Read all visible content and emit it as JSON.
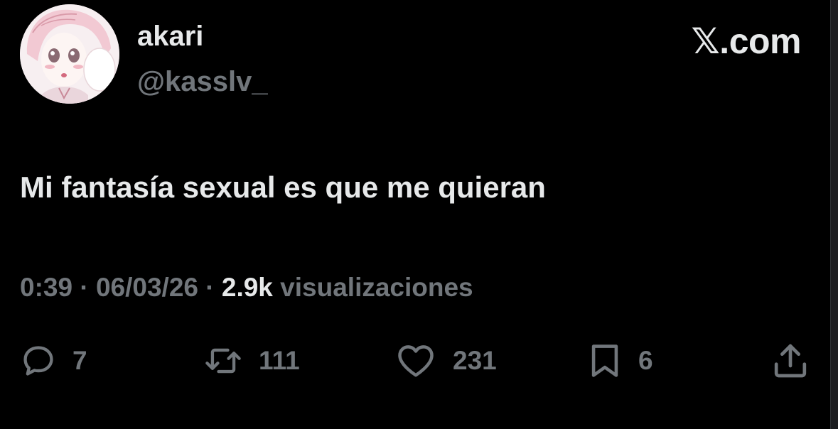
{
  "profile": {
    "display_name": "akari",
    "handle": "@kasslv_",
    "avatar": "anime-girl-avatar"
  },
  "brand": "𝕏.com",
  "tweet": {
    "text": "Mi fantasía sexual es que me quieran"
  },
  "meta": {
    "time": "0:39",
    "sep1": " · ",
    "date": "06/03/26",
    "sep2": " · ",
    "views_count": "2.9k",
    "views_label": " visualizaciones"
  },
  "actions": {
    "replies": {
      "icon": "reply-icon",
      "count": "7"
    },
    "reposts": {
      "icon": "repost-icon",
      "count": "111"
    },
    "likes": {
      "icon": "heart-icon",
      "count": "231"
    },
    "bookmarks": {
      "icon": "bookmark-icon",
      "count": "6"
    },
    "share": {
      "icon": "share-icon"
    }
  },
  "colors": {
    "background": "#000000",
    "primary_text": "#e7e9ea",
    "secondary_text": "#71767b"
  }
}
